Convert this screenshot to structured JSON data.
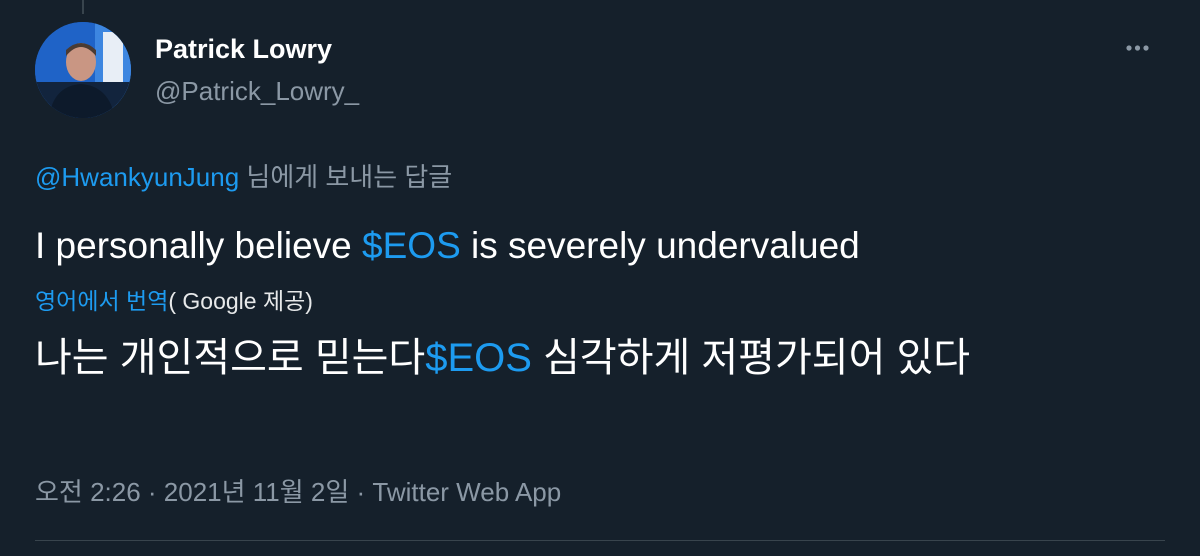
{
  "author": {
    "display_name": "Patrick Lowry",
    "handle": "@Patrick_Lowry_"
  },
  "more_icon": "more-horizontal-icon",
  "reply_context": {
    "mention": "@HwankyunJung",
    "suffix": " 님에게 보내는 답글"
  },
  "tweet": {
    "text_before": "I personally believe ",
    "cashtag": "$EOS",
    "text_after": " is severely undervalued"
  },
  "translation": {
    "link_label": "영어에서 번역",
    "provider": "( Google 제공)",
    "text_before": "나는 개인적으로 믿는다",
    "cashtag": "$EOS",
    "text_after": " 심각하게 저평가되어 있다"
  },
  "meta": {
    "time": "오전 2:26",
    "separator1": " · ",
    "date": "2021년 11월 2일",
    "separator2": " · ",
    "source": "Twitter Web App"
  },
  "colors": {
    "background": "#15202b",
    "text": "#ffffff",
    "secondary_text": "#8b98a5",
    "accent": "#1d9bf0",
    "divider": "#38444d"
  }
}
